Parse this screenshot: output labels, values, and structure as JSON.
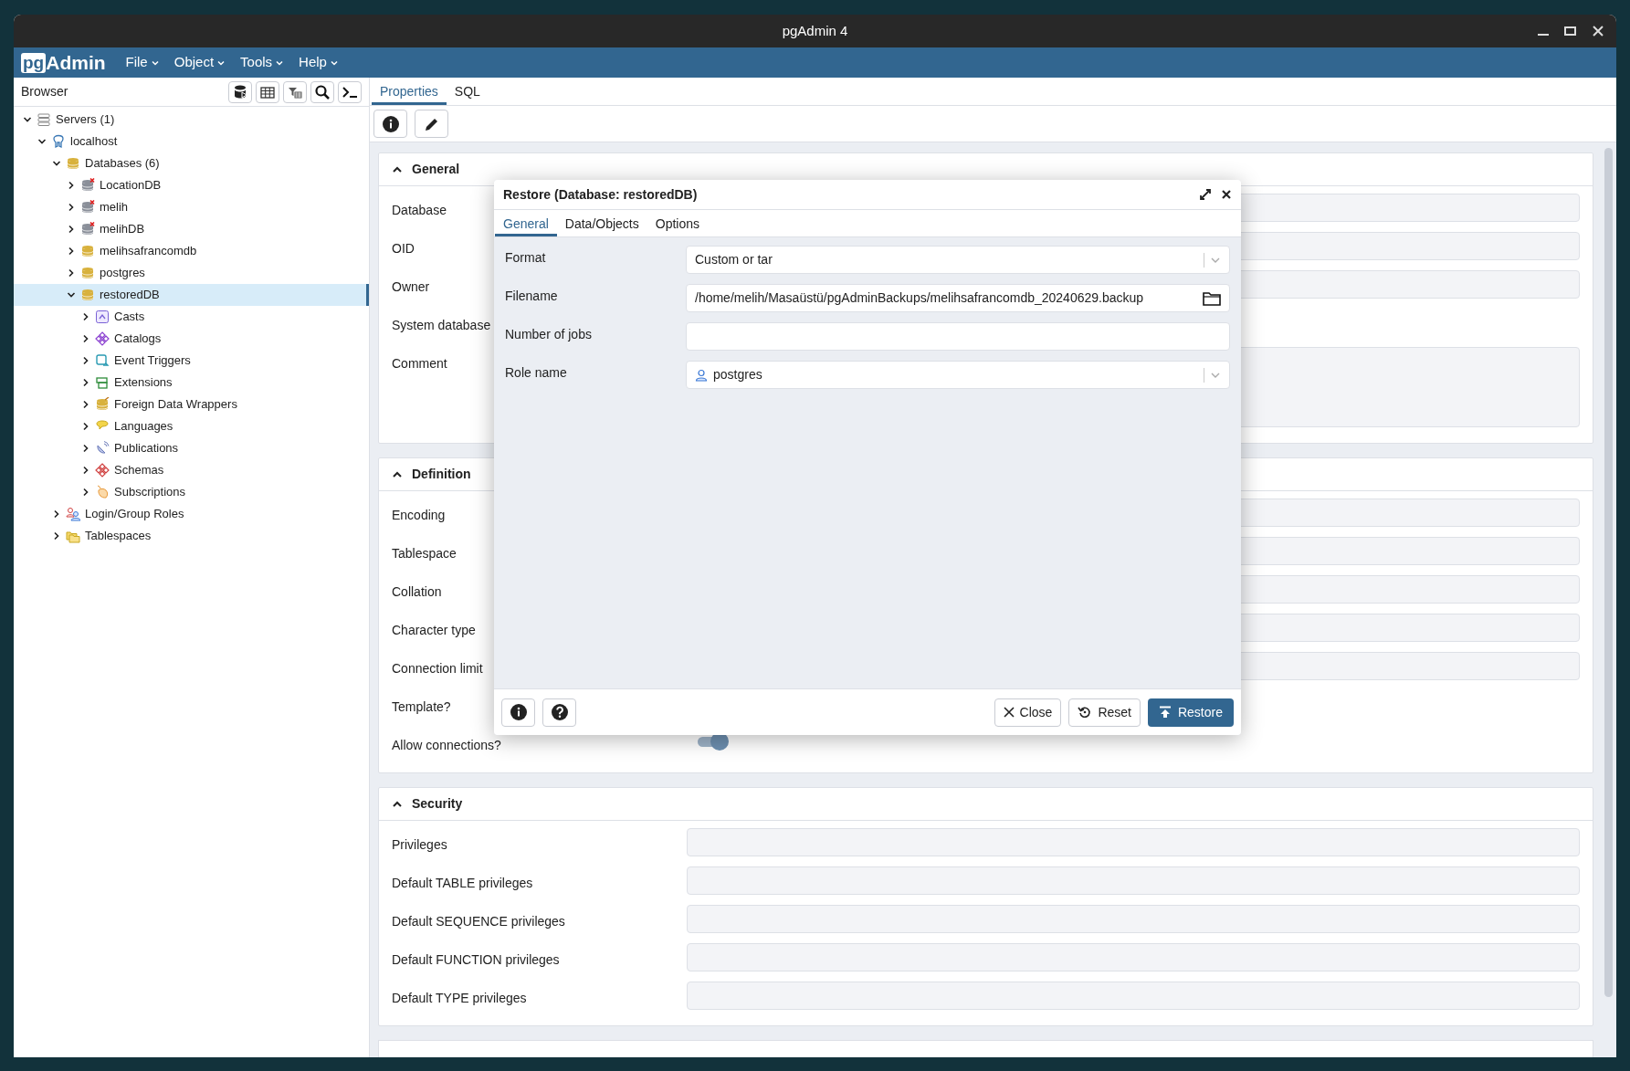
{
  "window": {
    "title": "pgAdmin 4"
  },
  "logo": {
    "boxed": "pg",
    "text": "Admin"
  },
  "menu": [
    "File",
    "Object",
    "Tools",
    "Help"
  ],
  "browser": {
    "title": "Browser"
  },
  "tree": [
    {
      "label": "Servers (1)",
      "kind": "server-group",
      "expanded": true,
      "selected": false,
      "children": [
        {
          "label": "localhost",
          "kind": "server",
          "expanded": true,
          "selected": false,
          "children": [
            {
              "label": "Databases (6)",
              "kind": "databases",
              "expanded": true,
              "selected": false,
              "children": [
                {
                  "label": "LocationDB",
                  "kind": "database",
                  "connected": false,
                  "expanded": false,
                  "selected": false
                },
                {
                  "label": "melih",
                  "kind": "database",
                  "connected": false,
                  "expanded": false,
                  "selected": false
                },
                {
                  "label": "melihDB",
                  "kind": "database",
                  "connected": false,
                  "expanded": false,
                  "selected": false
                },
                {
                  "label": "melihsafrancomdb",
                  "kind": "database",
                  "connected": true,
                  "expanded": false,
                  "selected": false
                },
                {
                  "label": "postgres",
                  "kind": "database",
                  "connected": true,
                  "expanded": false,
                  "selected": false
                },
                {
                  "label": "restoredDB",
                  "kind": "database",
                  "connected": true,
                  "expanded": true,
                  "selected": true,
                  "children": [
                    {
                      "label": "Casts",
                      "kind": "casts",
                      "expanded": false,
                      "selected": false
                    },
                    {
                      "label": "Catalogs",
                      "kind": "catalogs",
                      "expanded": false,
                      "selected": false
                    },
                    {
                      "label": "Event Triggers",
                      "kind": "triggers",
                      "expanded": false,
                      "selected": false
                    },
                    {
                      "label": "Extensions",
                      "kind": "extensions",
                      "expanded": false,
                      "selected": false
                    },
                    {
                      "label": "Foreign Data Wrappers",
                      "kind": "fdw",
                      "expanded": false,
                      "selected": false
                    },
                    {
                      "label": "Languages",
                      "kind": "languages",
                      "expanded": false,
                      "selected": false
                    },
                    {
                      "label": "Publications",
                      "kind": "publications",
                      "expanded": false,
                      "selected": false
                    },
                    {
                      "label": "Schemas",
                      "kind": "schemas",
                      "expanded": false,
                      "selected": false
                    },
                    {
                      "label": "Subscriptions",
                      "kind": "subscriptions",
                      "expanded": false,
                      "selected": false
                    }
                  ]
                }
              ]
            },
            {
              "label": "Login/Group Roles",
              "kind": "roles",
              "expanded": false,
              "selected": false
            },
            {
              "label": "Tablespaces",
              "kind": "tablespaces",
              "expanded": false,
              "selected": false
            }
          ]
        }
      ]
    }
  ],
  "panel_tabs": [
    {
      "label": "Properties",
      "selected": true
    },
    {
      "label": "SQL",
      "selected": false
    }
  ],
  "sections": [
    {
      "title": "General",
      "expanded": true,
      "fields": [
        {
          "label": "Database",
          "kind": "text"
        },
        {
          "label": "OID",
          "kind": "text"
        },
        {
          "label": "Owner",
          "kind": "text"
        },
        {
          "label": "System database",
          "kind": "bare"
        },
        {
          "label": "Comment",
          "kind": "textarea"
        }
      ]
    },
    {
      "title": "Definition",
      "expanded": true,
      "fields": [
        {
          "label": "Encoding",
          "kind": "text"
        },
        {
          "label": "Tablespace",
          "kind": "text"
        },
        {
          "label": "Collation",
          "kind": "text"
        },
        {
          "label": "Character type",
          "kind": "text"
        },
        {
          "label": "Connection limit",
          "kind": "text"
        },
        {
          "label": "Template?",
          "kind": "bare"
        },
        {
          "label": "Allow connections?",
          "kind": "switch",
          "checked": true
        }
      ]
    },
    {
      "title": "Security",
      "expanded": true,
      "fields": [
        {
          "label": "Privileges",
          "kind": "text"
        },
        {
          "label": "Default TABLE privileges",
          "kind": "text"
        },
        {
          "label": "Default SEQUENCE privileges",
          "kind": "text"
        },
        {
          "label": "Default FUNCTION privileges",
          "kind": "text"
        },
        {
          "label": "Default TYPE privileges",
          "kind": "text"
        }
      ]
    }
  ],
  "dialog": {
    "title": "Restore (Database: restoredDB)",
    "tabs": [
      {
        "label": "General",
        "selected": true
      },
      {
        "label": "Data/Objects",
        "selected": false
      },
      {
        "label": "Options",
        "selected": false
      }
    ],
    "fields": [
      {
        "label": "Format",
        "kind": "select",
        "value": "Custom or tar"
      },
      {
        "label": "Filename",
        "kind": "file",
        "value": "/home/melih/Masaüstü/pgAdminBackups/melihsafrancomdb_20240629.backup"
      },
      {
        "label": "Number of jobs",
        "kind": "text"
      },
      {
        "label": "Role name",
        "kind": "role-select",
        "value": "postgres"
      }
    ],
    "buttons": [
      {
        "label": "Close",
        "kind": "close"
      },
      {
        "label": "Reset",
        "kind": "reset"
      },
      {
        "label": "Restore",
        "kind": "primary"
      }
    ]
  }
}
